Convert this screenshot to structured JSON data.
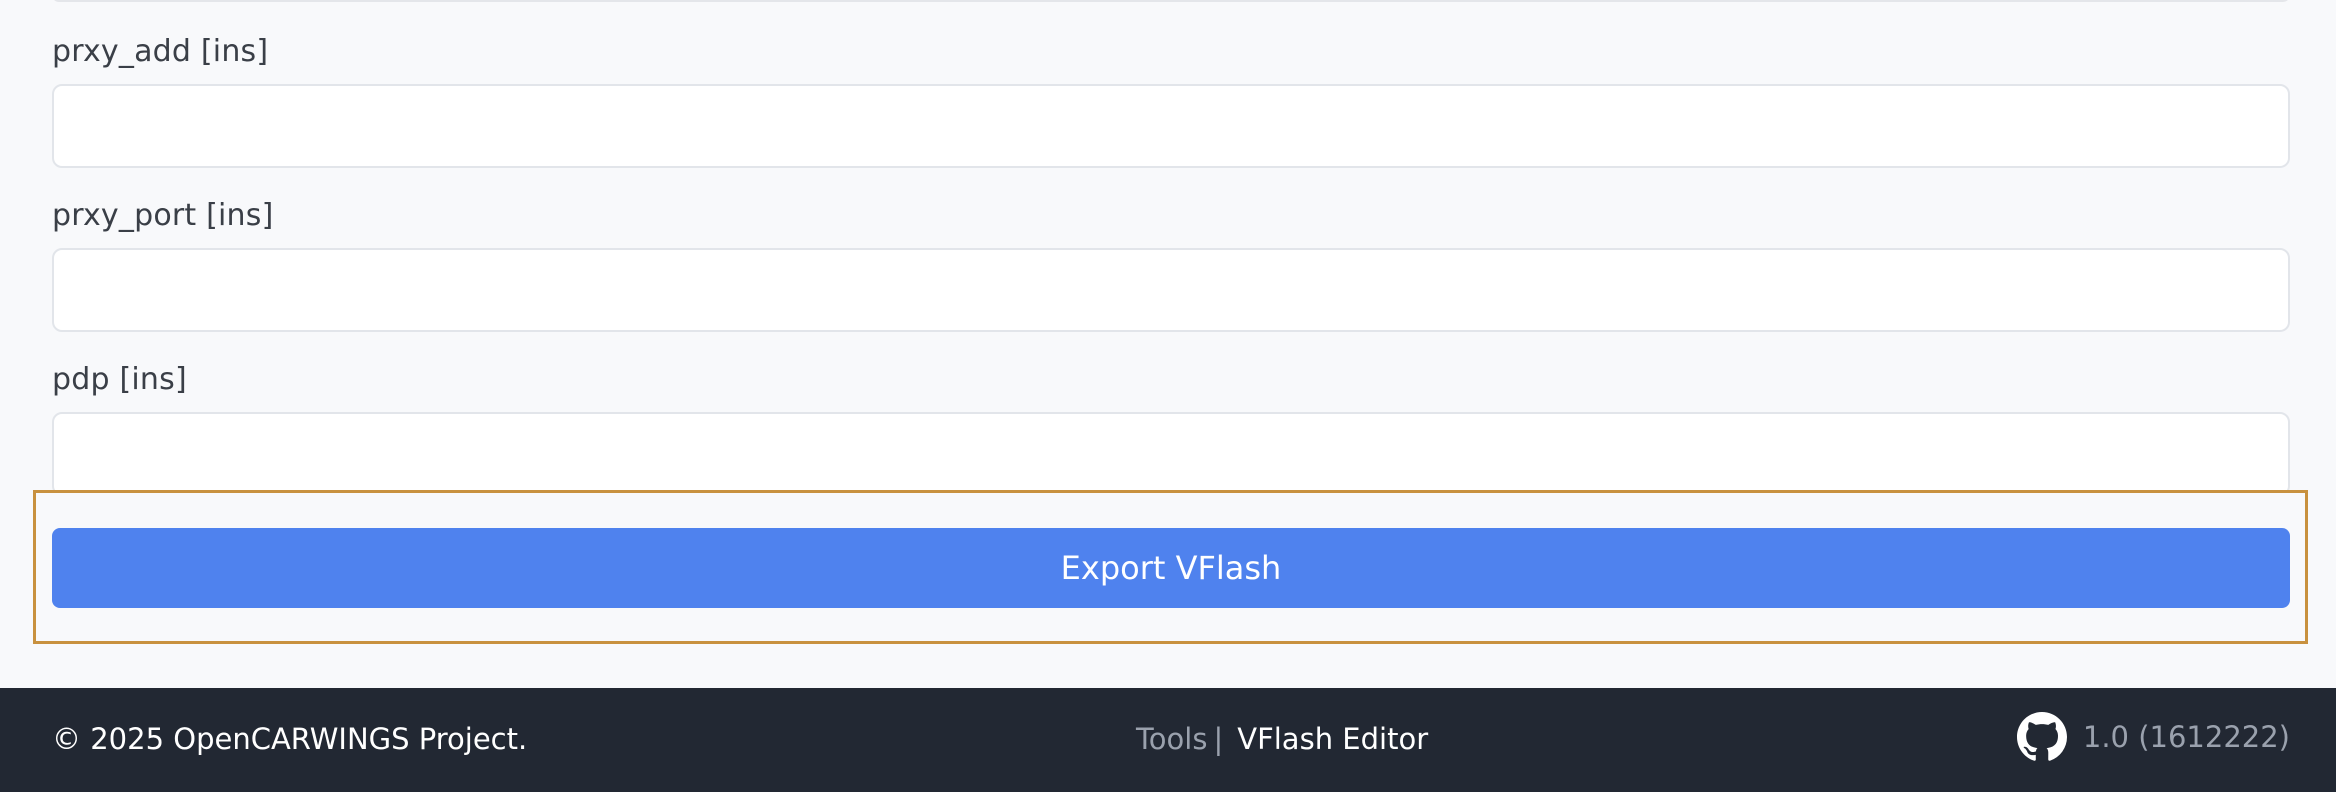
{
  "form": {
    "fields": [
      {
        "label": "prxy_add [ins]",
        "value": "",
        "placeholder": ""
      },
      {
        "label": "prxy_port [ins]",
        "value": "",
        "placeholder": ""
      },
      {
        "label": "pdp [ins]",
        "value": "",
        "placeholder": ""
      }
    ],
    "export_button_label": "Export VFlash"
  },
  "footer": {
    "copyright": "© 2025 OpenCARWINGS Project.",
    "nav_tools": "Tools",
    "nav_separator": "|",
    "nav_current": "VFlash Editor",
    "github_icon": "github-icon",
    "version": "1.0 (1612222)"
  },
  "colors": {
    "accent": "#4f82ee",
    "footer_bg": "#222833",
    "highlight_border": "#c8913f",
    "page_bg": "#f8f9fb"
  }
}
